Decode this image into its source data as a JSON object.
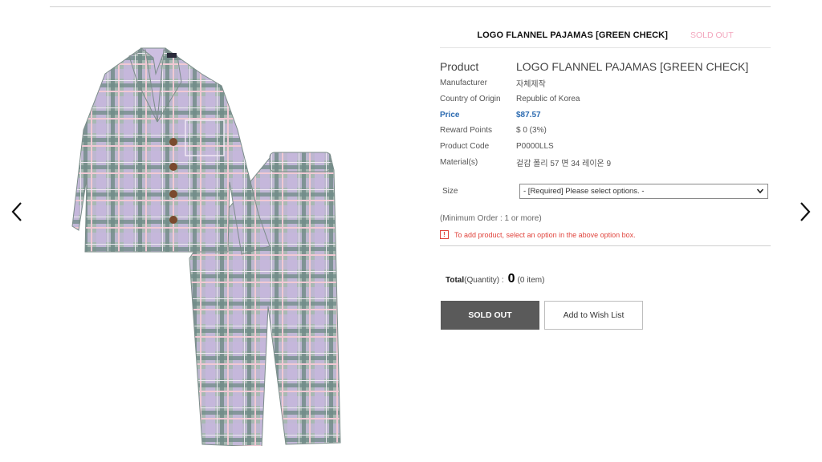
{
  "product": {
    "title": "LOGO FLANNEL PAJAMAS [GREEN CHECK]",
    "status_badge": "SOLD OUT",
    "details": [
      {
        "label": "Product",
        "value": "LOGO FLANNEL PAJAMAS [GREEN CHECK]"
      },
      {
        "label": "Manufacturer",
        "value": "자체제작"
      },
      {
        "label": "Country of Origin",
        "value": "Republic of Korea"
      },
      {
        "label": "Price",
        "value": "$87.57"
      },
      {
        "label": "Reward Points",
        "value": "$ 0 (3%)"
      },
      {
        "label": "Product Code",
        "value": "P0000LLS"
      },
      {
        "label": "Material(s)",
        "value": "겉감 폴리 57 면 34 레이온 9"
      }
    ]
  },
  "options": {
    "size_label": "Size",
    "size_selected": "- [Required] Please select options. -"
  },
  "min_order": "(Minimum Order : 1 or more)",
  "warning": {
    "icon": "!",
    "text": "To add product, select an option in the above option box."
  },
  "total": {
    "label": "Total",
    "qualifier": "(Quantity) :",
    "quantity": "0",
    "items": "(0 item)"
  },
  "buttons": {
    "sold_out": "SOLD OUT",
    "wishlist": "Add to Wish List"
  },
  "icons": {
    "prev": "chevron-left-icon",
    "next": "chevron-right-icon",
    "select": "chevron-down-icon"
  },
  "colors": {
    "price": "#2b6ab0",
    "sold_out_badge": "#f3a6bd",
    "warning": "#e0443d",
    "sold_out_button": "#5a5a5a"
  }
}
